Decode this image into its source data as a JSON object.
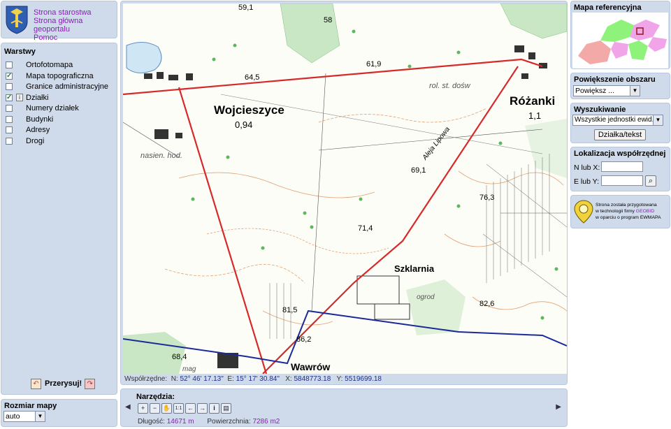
{
  "header": {
    "links": [
      "Strona starostwa",
      "Strona główna geoportalu",
      "Pomoc"
    ]
  },
  "layers": {
    "title": "Warstwy",
    "items": [
      {
        "label": "Ortofotomapa",
        "checked": false
      },
      {
        "label": "Mapa topograficzna",
        "checked": true
      },
      {
        "label": "Granice administracyjne",
        "checked": false
      },
      {
        "label": "Działki",
        "checked": true
      },
      {
        "label": "Numery działek",
        "checked": false
      },
      {
        "label": "Budynki",
        "checked": false
      },
      {
        "label": "Adresy",
        "checked": false
      },
      {
        "label": "Drogi",
        "checked": false
      }
    ],
    "redraw_label": "Przerysuj!"
  },
  "map_size": {
    "title": "Rozmiar mapy",
    "selected": "auto"
  },
  "reference_map": {
    "title": "Mapa referencyjna"
  },
  "zoom_area": {
    "title": "Powiększenie obszaru",
    "selected": "Powiększ ..."
  },
  "search": {
    "title": "Wyszukiwanie",
    "selected": "Wszystkie jednostki ewid.",
    "button": "Działka/tekst"
  },
  "coord_location": {
    "title": "Lokalizacja współrzędnej",
    "n_label": "N lub X:",
    "e_label": "E lub Y:",
    "n_value": "",
    "e_value": ""
  },
  "geobid": {
    "line1": "Strona została przygotowana",
    "line2_prefix": "w technologii firmy ",
    "line2_brand": "GEOBID",
    "line3": "w oparciu o program EWMAPA"
  },
  "coords": {
    "label": "Współrzędne:",
    "n_label": "N:",
    "n_value": "52° 46' 17.13\"",
    "e_label": "E:",
    "e_value": "15° 17' 30.84\"",
    "x_label": "X:",
    "x_value": "5848773.18",
    "y_label": "Y:",
    "y_value": "5519699.18"
  },
  "tools": {
    "title": "Narzędzia:",
    "length_label": "Długość:",
    "length_value": "14671 m",
    "area_label": "Powierzchnia:",
    "area_value": "7286 m2",
    "scale_label": "1:1"
  },
  "map_labels": {
    "wojcieszyce": "Wojcieszyce",
    "wojcieszyce_val": "0,94",
    "rozanki": "Różanki",
    "rozanki_val": "1,1",
    "szklarnia": "Szklarnia",
    "wawrow": "Wawrów",
    "aleja": "Aleja Lipowa",
    "rol_st": "rol. st. dośw",
    "nasien": "nasien. hod.",
    "ogrod": "ogrod",
    "mag": "mag",
    "elev": [
      "59,1",
      "58",
      "61,9",
      "64,5",
      "69,1",
      "76,3",
      "71,4",
      "82,6",
      "81,5",
      "86,2",
      "68,4"
    ]
  },
  "colors": {
    "panel_bg": "#cfdaea",
    "link": "#8a1fb5",
    "coord_value": "#1a2f8a",
    "road_red": "#d62a2a",
    "boundary_blue": "#1a2a9a"
  }
}
